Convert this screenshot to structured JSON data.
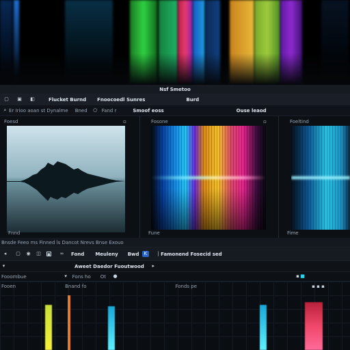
{
  "colors": {
    "accent": "#2a63c8",
    "playhead": "#e07b2c",
    "clip_yellow": "#e6e02a",
    "clip_cyan": "#29d3e6",
    "clip_red": "#e4325b"
  },
  "header": {
    "title": "Nsf Smetoo"
  },
  "toolbar": {
    "label_1": "Flucket Burnd",
    "label_2": "Fnoocoedl Sunres",
    "label_3": "Burd"
  },
  "media_bar": {
    "label_1": "Er Irioo aoan st Dynalme",
    "label_2": "Bned",
    "label_3": "Fand r",
    "label_4": "Smoof eoss",
    "label_5": "Ouse leaod"
  },
  "panels": [
    {
      "head": "Foesd",
      "foot": "Fnnd"
    },
    {
      "head": "Fosone",
      "foot": "Fune"
    },
    {
      "head": "Foeltind",
      "foot": "Fime"
    }
  ],
  "lower_bar": {
    "text": "Bnsde Feeo ms Finned ls Dancot Nrevs Bnse Exouo"
  },
  "controls": {
    "label_1": "Fond",
    "label_2": "Meuleny",
    "label_3": "Bwd",
    "badge": "K",
    "label_4": "Famonend Fosecid sed"
  },
  "sub_controls": {
    "label_1": "Aweet Daedor Fuoutwood"
  },
  "track_row_1": {
    "label_1": "Fooombue",
    "label_2": "Fons ho",
    "label_3": "Ot"
  },
  "track_row_2": {
    "label_1": "Fooen",
    "label_2": "Bnand fo",
    "label_3": "Fonds pe"
  }
}
